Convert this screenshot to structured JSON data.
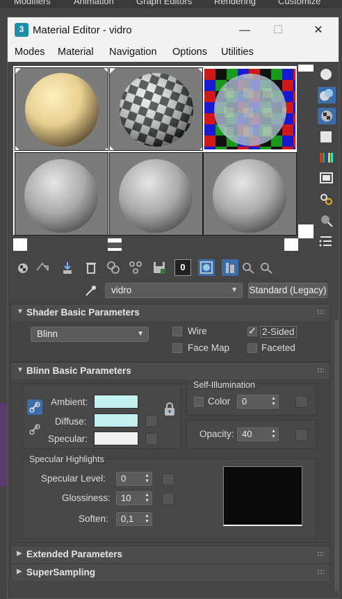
{
  "outer_menu": [
    "Modifiers",
    "Animation",
    "Graph Editors",
    "Rendering",
    "Customize"
  ],
  "window": {
    "app_icon": "3",
    "title": "Material Editor - vidro",
    "minimize": "—",
    "maximize": "☐",
    "close": "✕"
  },
  "menu": [
    "Modes",
    "Material",
    "Navigation",
    "Options",
    "Utilities"
  ],
  "toolbar": {
    "multiplier_label": "0"
  },
  "material": {
    "name": "vidro",
    "type_button": "Standard (Legacy)"
  },
  "shader_rollout": {
    "title": "Shader Basic Parameters",
    "shader": "Blinn",
    "wire": "Wire",
    "wire_checked": false,
    "two_sided": "2-Sided",
    "two_sided_checked": true,
    "face_map": "Face Map",
    "face_map_checked": false,
    "faceted": "Faceted",
    "faceted_checked": false
  },
  "blinn_rollout": {
    "title": "Blinn Basic Parameters",
    "ambient_label": "Ambient:",
    "diffuse_label": "Diffuse:",
    "specular_label": "Specular:",
    "ambient_color": "#c4f1f0",
    "diffuse_color": "#c4f1f0",
    "specular_color": "#f2f2f2",
    "self_illum_title": "Self-Illumination",
    "color_label": "Color",
    "color_value": "0",
    "opacity_label": "Opacity:",
    "opacity_value": "40",
    "spec_title": "Specular Highlights",
    "spec_level_label": "Specular Level:",
    "spec_level_value": "0",
    "gloss_label": "Glossiness:",
    "gloss_value": "10",
    "soften_label": "Soften:",
    "soften_value": "0,1"
  },
  "extended_rollout": {
    "title": "Extended Parameters"
  },
  "supersampling_rollout": {
    "title": "SuperSampling"
  }
}
